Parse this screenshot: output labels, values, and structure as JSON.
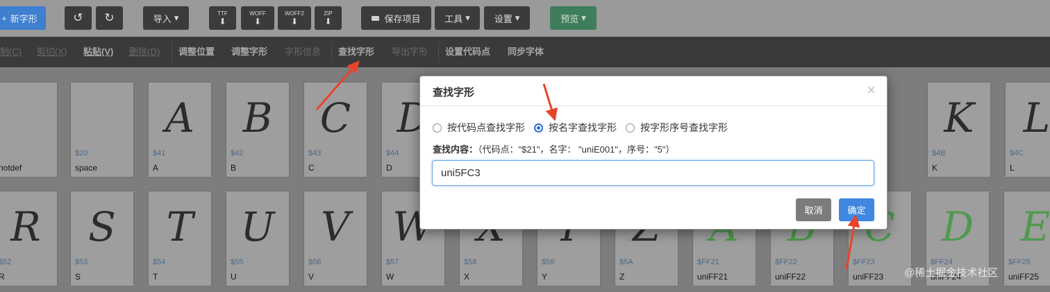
{
  "toolbar": {
    "new_glyph": "新字形",
    "undo_icon": "↺",
    "redo_icon": "↻",
    "import": "导入",
    "ttf": "TTF",
    "woff": "WOFF",
    "woff2": "WOFF2",
    "zip": "ZIP",
    "download_arrow": "⬇",
    "save_project": "保存项目",
    "tools": "工具",
    "settings": "设置",
    "preview": "预览",
    "chevron": "▾",
    "colors": {
      "primary": "#3f87e0",
      "dark": "#3b3b3b",
      "success": "#3a9a62"
    }
  },
  "menu": {
    "copy": "制(C)",
    "cut": "剪切(X)",
    "paste": "粘贴(V)",
    "delete": "删除(D)",
    "adjust_position": "调整位置",
    "adjust_glyph": "调整字形",
    "glyph_info": "字形信息",
    "find_glyph": "查找字形",
    "export_glyph": "导出字形",
    "set_codepoint": "设置代码点",
    "sync_font": "同步字体"
  },
  "glyphs_row1": [
    {
      "glyph": "",
      "code": "",
      "name": "notdef"
    },
    {
      "glyph": "",
      "code": "$20",
      "name": "space"
    },
    {
      "glyph": "A",
      "code": "$41",
      "name": "A"
    },
    {
      "glyph": "B",
      "code": "$42",
      "name": "B"
    },
    {
      "glyph": "C",
      "code": "$43",
      "name": "C"
    },
    {
      "glyph": "D",
      "code": "$44",
      "name": "D"
    },
    {
      "glyph": "K",
      "code": "$4B",
      "name": "K"
    },
    {
      "glyph": "L",
      "code": "$4C",
      "name": "L"
    }
  ],
  "glyphs_row2": [
    {
      "glyph": "R",
      "code": "$52",
      "name": "R"
    },
    {
      "glyph": "S",
      "code": "$53",
      "name": "S"
    },
    {
      "glyph": "T",
      "code": "$54",
      "name": "T"
    },
    {
      "glyph": "U",
      "code": "$55",
      "name": "U"
    },
    {
      "glyph": "V",
      "code": "$56",
      "name": "V"
    },
    {
      "glyph": "W",
      "code": "$57",
      "name": "W"
    },
    {
      "glyph": "X",
      "code": "$58",
      "name": "X"
    },
    {
      "glyph": "Y",
      "code": "$59",
      "name": "Y"
    },
    {
      "glyph": "Z",
      "code": "$5A",
      "name": "Z"
    },
    {
      "glyph": "A",
      "code": "$FF21",
      "name": "uniFF21"
    },
    {
      "glyph": "B",
      "code": "$FF22",
      "name": "uniFF22"
    },
    {
      "glyph": "C",
      "code": "$FF23",
      "name": "uniFF23"
    },
    {
      "glyph": "D",
      "code": "$FF24",
      "name": "uniFF24"
    },
    {
      "glyph": "E",
      "code": "$FF25",
      "name": "uniFF25"
    }
  ],
  "dialog": {
    "title": "查找字形",
    "close_icon": "×",
    "options": [
      "按代码点查找字形",
      "按名字查找字形",
      "按字形序号查找字形"
    ],
    "selected_option": "按名字查找字形",
    "search_label": "查找内容：",
    "search_hint": "（代码点：\"$21\"，名字： \"uniE001\"，序号：\"5\"）",
    "search_value": "uni5FC3",
    "cancel": "取消",
    "ok": "确定"
  },
  "watermark": "@稀土掘金技术社区"
}
